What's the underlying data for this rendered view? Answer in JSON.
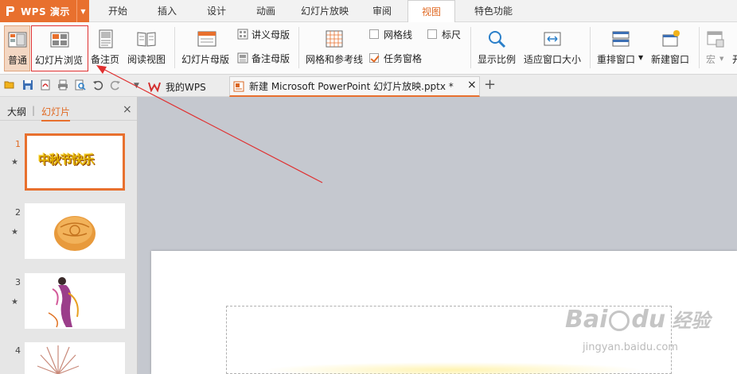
{
  "menubar": {
    "app_title": "WPS 演示",
    "tabs": [
      "开始",
      "插入",
      "设计",
      "动画",
      "幻灯片放映",
      "审阅",
      "视图",
      "特色功能"
    ],
    "active_tab": "视图"
  },
  "ribbon": {
    "normal": "普通",
    "slide_sorter": "幻灯片浏览",
    "notes_page": "备注页",
    "reading_view": "阅读视图",
    "slide_master": "幻灯片母版",
    "handout_master": "讲义母版",
    "notes_master": "备注母版",
    "grid_guides": "网格和参考线",
    "gridlines": "网格线",
    "ruler": "标尺",
    "task_pane": "任务窗格",
    "zoom": "显示比例",
    "fit_window": "适应窗口大小",
    "arrange": "重排窗口",
    "new_window": "新建窗口",
    "macro": "宏",
    "cut_off": "开",
    "gridlines_checked": false,
    "ruler_checked": false,
    "task_pane_checked": true
  },
  "docbar": {
    "my_wps": "我的WPS",
    "file_tab": "新建 Microsoft PowerPoint 幻灯片放映.pptx *",
    "close": "×",
    "add": "+"
  },
  "sidepanel": {
    "tab_outline": "大纲",
    "divider": "|",
    "tab_slides": "幻灯片",
    "close": "×",
    "slides": [
      {
        "num": "1",
        "star": "★",
        "text": "中秋节快乐"
      },
      {
        "num": "2",
        "star": "★"
      },
      {
        "num": "3",
        "star": "★"
      },
      {
        "num": "4"
      }
    ]
  },
  "watermark": {
    "brand": "Bai",
    "brand2": "du",
    "cn": "经验",
    "url": "jingyan.baidu.com"
  },
  "colors": {
    "accent": "#e8702e",
    "annotation": "#e03030"
  }
}
